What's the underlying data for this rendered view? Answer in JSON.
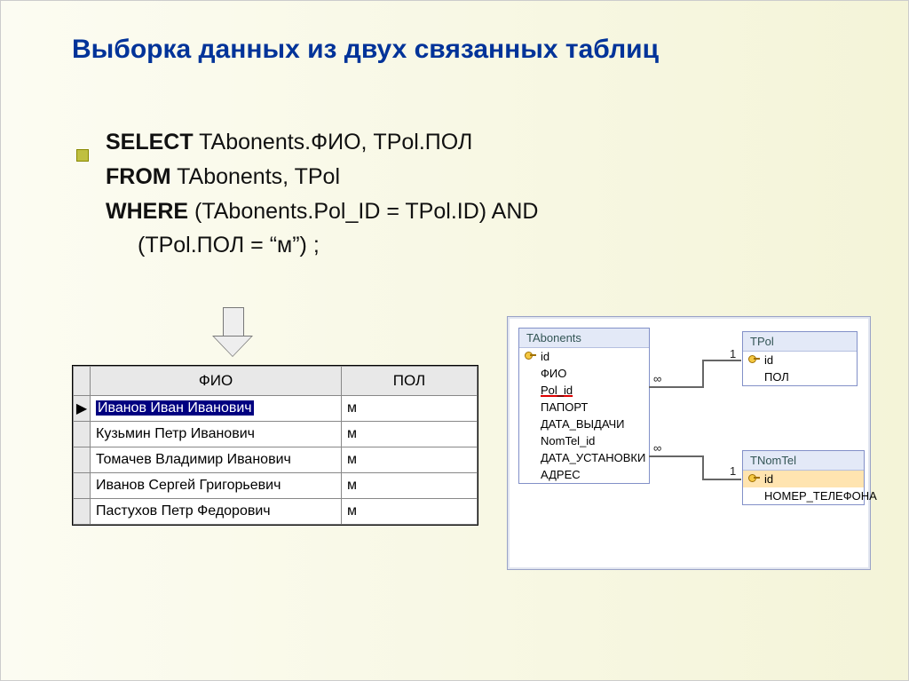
{
  "title": "Выборка данных из двух связанных таблиц",
  "sql": {
    "select_kw": "SELECT",
    "select_rest": " TAbonents.ФИО, TPol.ПОЛ",
    "from_kw": "FROM",
    "from_rest": " TAbonents, TPol",
    "where_kw": " WHERE",
    "where_rest": " (TAbonents.Pol_ID = TPol.ID) AND",
    "where_line2": "(TPol.ПОЛ = “м”) ;"
  },
  "result": {
    "headers": {
      "col0": "",
      "col1": "ФИО",
      "col2": "ПОЛ"
    },
    "rows": [
      {
        "marker": "▶",
        "fio": "Иванов Иван Иванович",
        "pol": "м",
        "selected": true
      },
      {
        "marker": "",
        "fio": "Кузьмин Петр Иванович",
        "pol": "м",
        "selected": false
      },
      {
        "marker": "",
        "fio": "Томачев Владимир Иванович",
        "pol": "м",
        "selected": false
      },
      {
        "marker": "",
        "fio": "Иванов Сергей Григорьевич",
        "pol": "м",
        "selected": false
      },
      {
        "marker": "",
        "fio": "Пастухов Петр Федорович",
        "pol": "м",
        "selected": false
      }
    ]
  },
  "schema": {
    "tabonents": {
      "name": "TAbonents",
      "fields": [
        "id",
        "ФИО",
        "Pol_id",
        "ПАПОРТ",
        "ДАТА_ВЫДАЧИ",
        "NomTel_id",
        "ДАТА_УСТАНОВКИ",
        "АДРЕС"
      ]
    },
    "tpol": {
      "name": "TPol",
      "fields": [
        "id",
        "ПОЛ"
      ]
    },
    "tnomtel": {
      "name": "TNomTel",
      "fields": [
        "id",
        "НОМЕР_ТЕЛЕФОНА"
      ]
    },
    "rel_labels": {
      "inf1": "∞",
      "one1": "1",
      "inf2": "∞",
      "one2": "1"
    }
  }
}
